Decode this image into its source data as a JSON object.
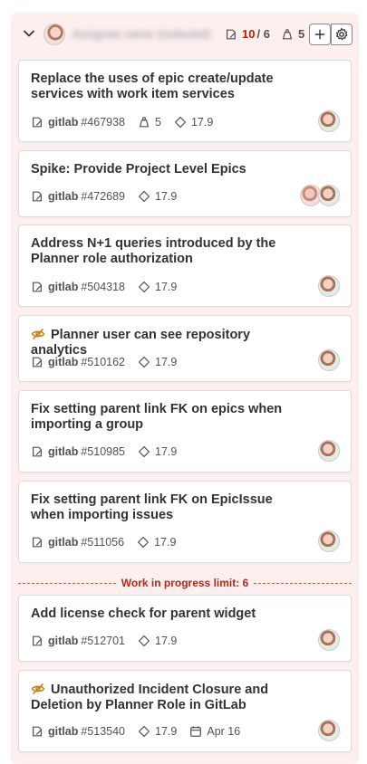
{
  "header": {
    "assignee_name": "Assignee name (redacted)",
    "issue_count": "10",
    "wip_limit": "/ 6",
    "weight_total": "5",
    "add_label": "+",
    "settings_label": "⚙"
  },
  "wip_limit_label": "Work in progress limit: 6",
  "cards": [
    {
      "title": "Replace the uses of epic create/update services with work item services",
      "project": "gitlab",
      "iid": "#467938",
      "weight": "5",
      "milestone": "17.9"
    },
    {
      "title": "Spike: Provide Project Level Epics",
      "project": "gitlab",
      "iid": "#472689",
      "milestone": "17.9"
    },
    {
      "title": "Address N+1 queries introduced by the Planner role authorization",
      "project": "gitlab",
      "iid": "#504318",
      "milestone": "17.9"
    },
    {
      "title": "Planner user can see repository analytics",
      "project": "gitlab",
      "iid": "#510162",
      "milestone": "17.9",
      "confidential": true
    },
    {
      "title": "Fix setting parent link FK on epics when importing a group",
      "project": "gitlab",
      "iid": "#510985",
      "milestone": "17.9"
    },
    {
      "title": "Fix setting parent link FK on EpicIssue when importing issues",
      "project": "gitlab",
      "iid": "#511056",
      "milestone": "17.9"
    },
    {
      "title": "Add license check for parent widget",
      "project": "gitlab",
      "iid": "#512701",
      "milestone": "17.9"
    },
    {
      "title": "Unauthorized Incident Closure and Deletion by Planner Role in GitLab",
      "project": "gitlab",
      "iid": "#513540",
      "milestone": "17.9",
      "due_date": "Apr 16",
      "confidential": true
    }
  ],
  "colors": {
    "list_background": "#fcefee",
    "wip_over": "#c91c00",
    "confidential": "#c17d10"
  }
}
